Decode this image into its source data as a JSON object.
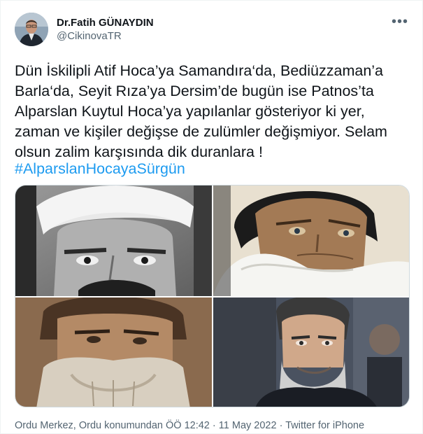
{
  "author": {
    "display_name": "Dr.Fatih GÜNAYDIN",
    "handle": "@CikinovaTR"
  },
  "more_menu_icon": "more-horizontal-icon",
  "tweet": {
    "text": "Dün İskilipli Atif Hoca’ya Samandıra‘da, Bediüzzaman’a\nBarla‘da, Seyit Rıza’ya Dersim’de bugün ise Patnos’ta\nAlparslan Kuytul Hoca’ya yapılanlar gösteriyor ki yer,\nzaman ve kişiler değişse de zulümler değişmiyor. Selam\nolsun zalim karşısında dik duranlara !",
    "hashtag": "#AlparslanHocayaSürgün"
  },
  "meta": {
    "location": "Ordu Merkez, Ordu konumundan",
    "time": "ÖÖ 12:42",
    "separator": "·",
    "date": "11 May 2022",
    "source": "Twitter for iPhone"
  },
  "colors": {
    "text": "#0f1419",
    "secondary": "#536471",
    "link": "#1d9bf0",
    "border": "#cfd9de"
  }
}
